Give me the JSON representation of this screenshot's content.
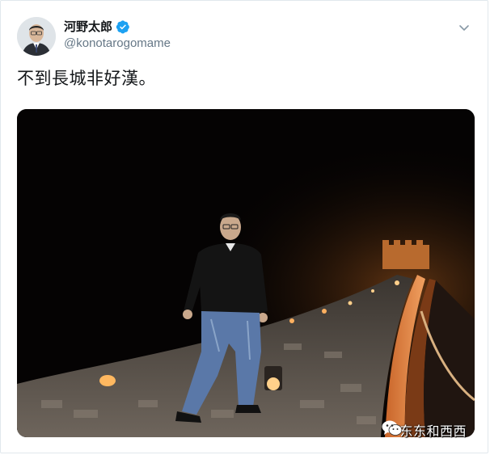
{
  "author": {
    "display_name": "河野太郎",
    "handle": "@konotarogomame",
    "verified": true
  },
  "tweet": {
    "text": "不到長城非好漢。"
  },
  "media": {
    "image_description": "photo-of-man-standing-on-great-wall-at-night"
  },
  "watermark": {
    "text": "东东和西西",
    "icon": "wechat-icon"
  },
  "icons": {
    "verified": "verified-badge-icon",
    "menu": "chevron-down-icon"
  },
  "colors": {
    "verified_blue": "#1da1f2",
    "handle_gray": "#657786",
    "text_dark": "#14171a",
    "border": "#e1e8ed",
    "wall_glow": "#e8893a"
  }
}
